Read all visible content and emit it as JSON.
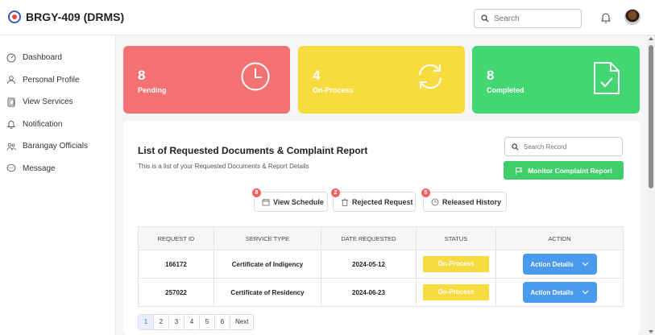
{
  "header": {
    "app_title": "BRGY-409 (DRMS)",
    "search_placeholder": "Search"
  },
  "sidebar": {
    "items": [
      {
        "label": "Dashboard",
        "icon": "dashboard-icon"
      },
      {
        "label": "Personal Profile",
        "icon": "user-icon"
      },
      {
        "label": "View Services",
        "icon": "document-icon"
      },
      {
        "label": "Notification",
        "icon": "bell-icon"
      },
      {
        "label": "Barangay Officials",
        "icon": "officials-icon"
      },
      {
        "label": "Message",
        "icon": "message-icon"
      }
    ]
  },
  "stats": {
    "pending": {
      "value": "8",
      "label": "Pending",
      "color": "#f47272"
    },
    "on_process": {
      "value": "4",
      "label": "On-Process",
      "color": "#f7db3f"
    },
    "completed": {
      "value": "8",
      "label": "Completed",
      "color": "#44d673"
    }
  },
  "panel": {
    "title": "List of Requested Documents & Complaint Report",
    "subtitle": "This is a list of your Requested Documents & Report Details",
    "search_placeholder": "Search Record",
    "monitor_label": "Monitor Complaint Report",
    "pills": [
      {
        "label": "View Schedule",
        "badge": "8"
      },
      {
        "label": "Rejected Request",
        "badge": "2"
      },
      {
        "label": "Released History",
        "badge": "5"
      }
    ]
  },
  "table": {
    "headers": [
      "REQUEST ID",
      "SERVICE TYPE",
      "DATE REQUESTED",
      "STATUS",
      "ACTION"
    ],
    "rows": [
      {
        "id": "166172",
        "service": "Certificate of Indigency",
        "date": "2024-05-12",
        "status": "On-Process",
        "action": "Action Details"
      },
      {
        "id": "257022",
        "service": "Certificate of Residency",
        "date": "2024-06-23",
        "status": "On-Process",
        "action": "Action Details"
      }
    ]
  },
  "pagination": {
    "pages": [
      "1",
      "2",
      "3",
      "4",
      "5",
      "6"
    ],
    "current": "1",
    "next_label": "Next"
  }
}
